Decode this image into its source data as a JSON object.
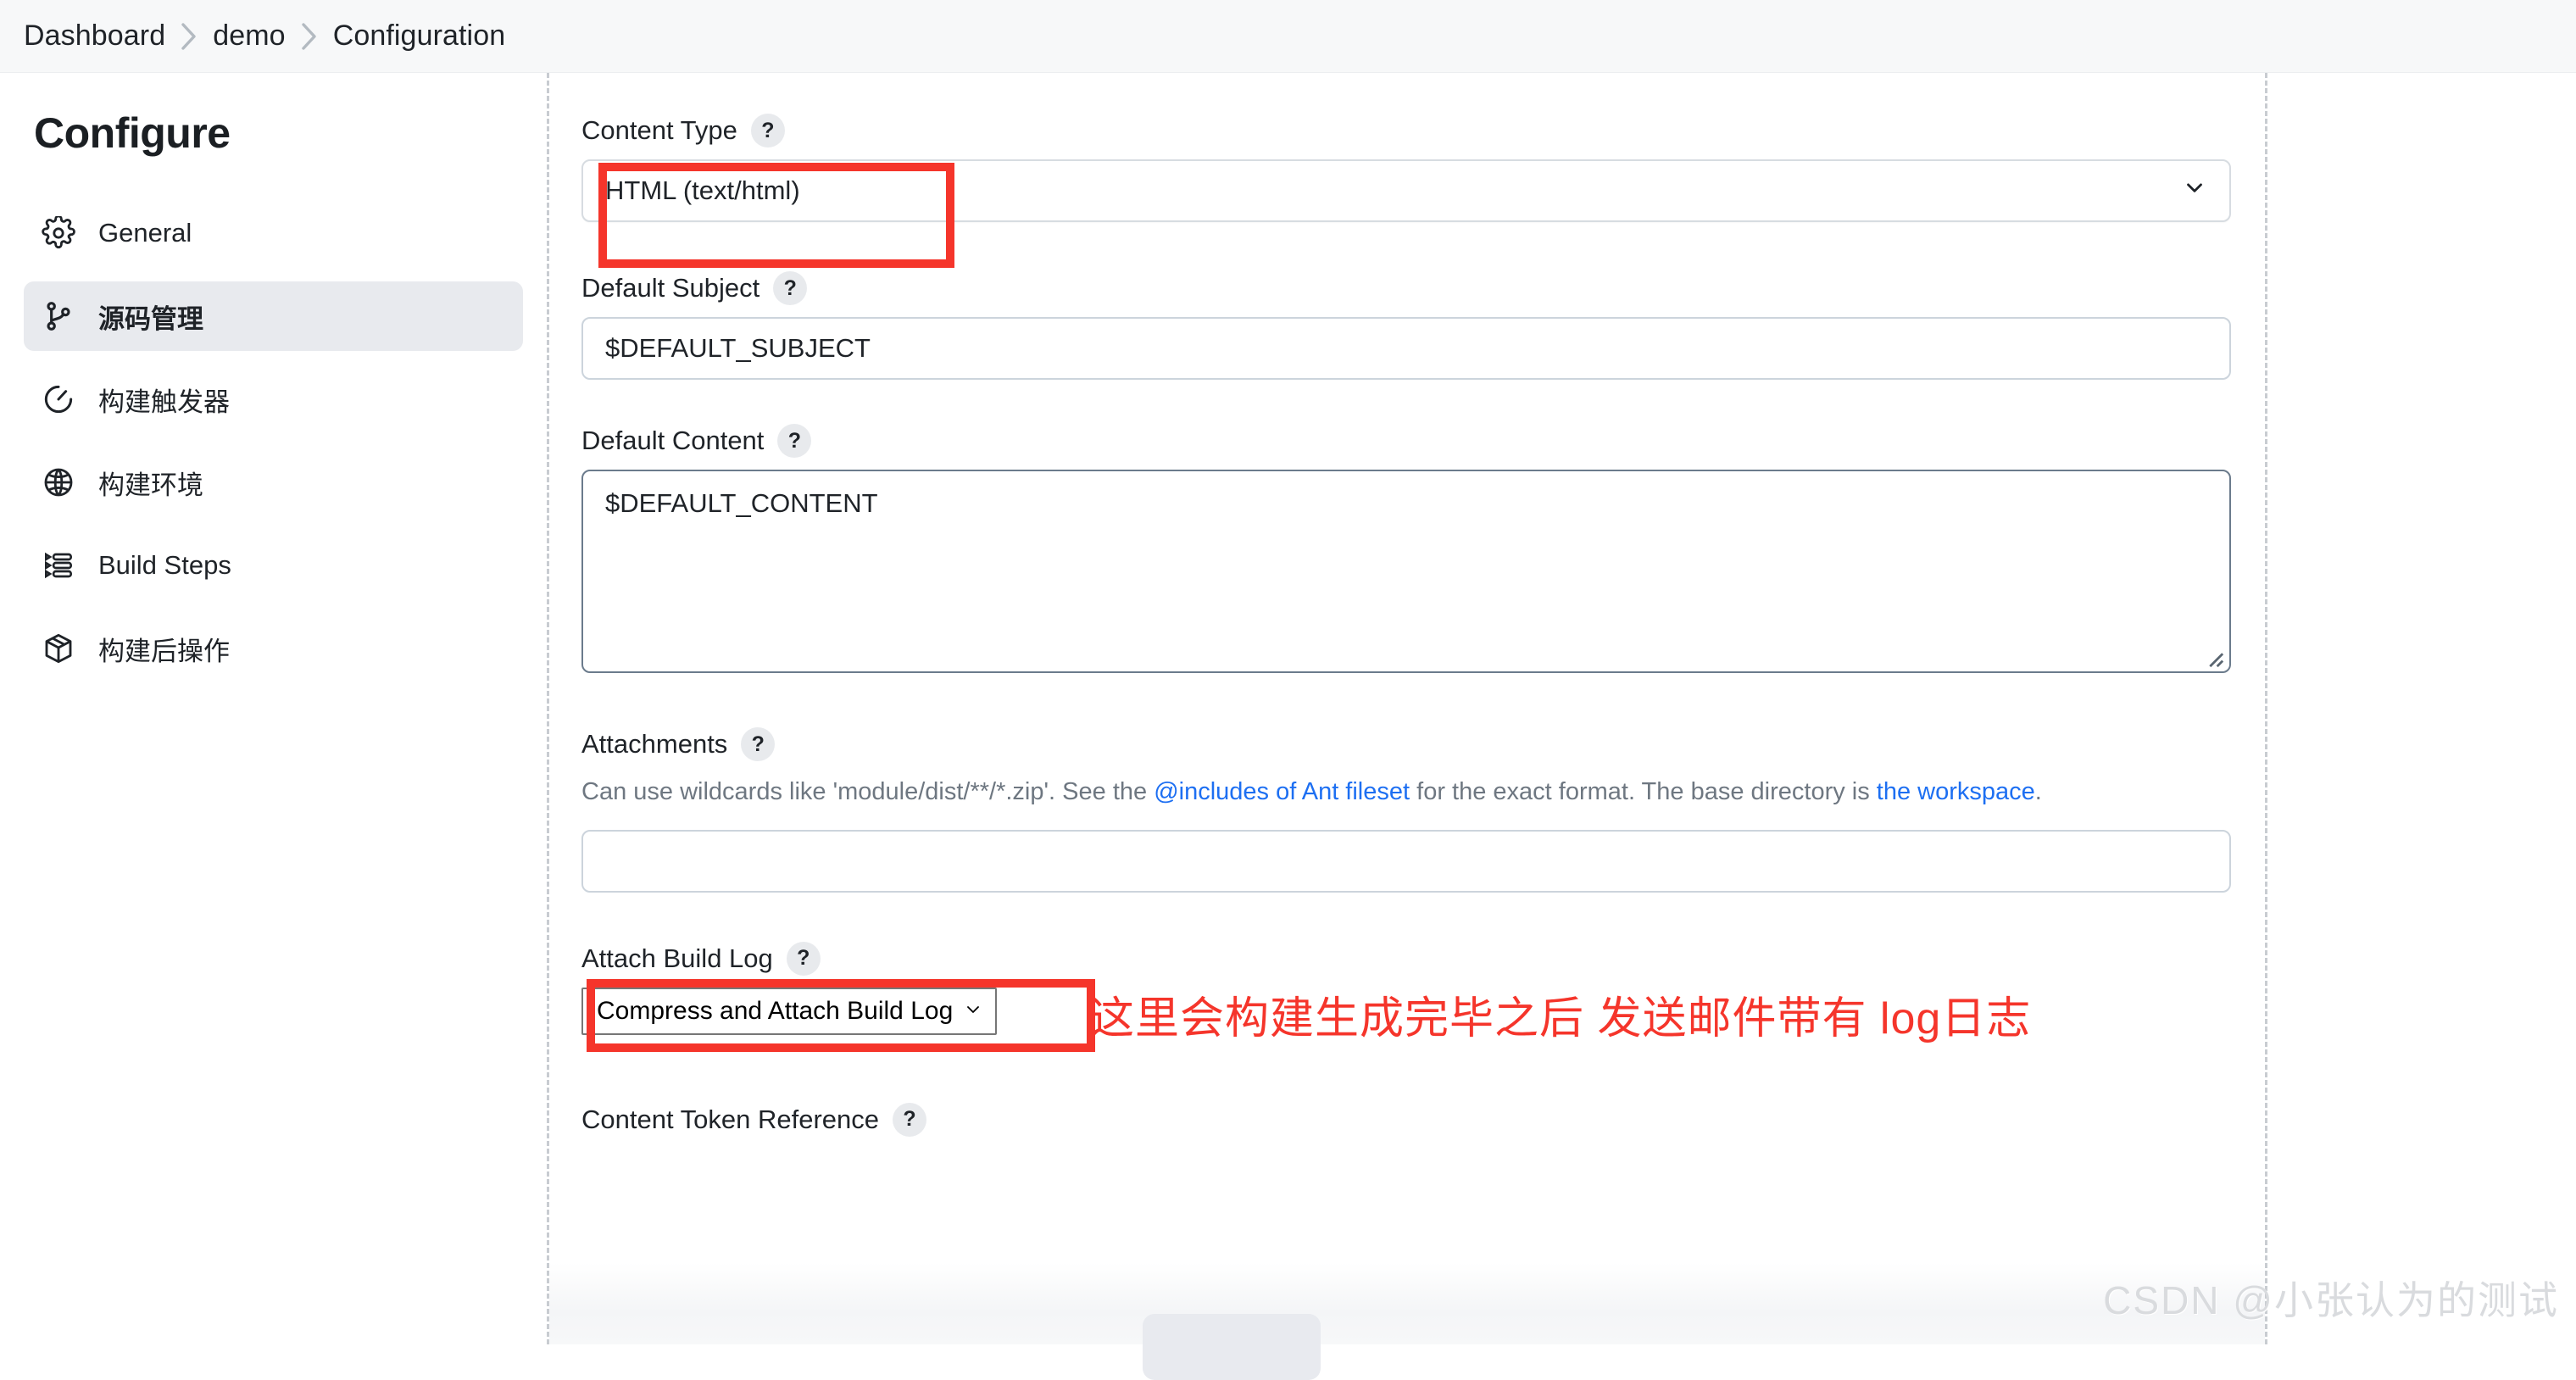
{
  "breadcrumb": {
    "items": [
      {
        "label": "Dashboard"
      },
      {
        "label": "demo"
      },
      {
        "label": "Configuration"
      }
    ],
    "separator_icon": "chevron-right-icon"
  },
  "sidebar": {
    "title": "Configure",
    "items": [
      {
        "label": "General",
        "icon": "gear-icon",
        "active": false
      },
      {
        "label": "源码管理",
        "icon": "branch-icon",
        "active": true
      },
      {
        "label": "构建触发器",
        "icon": "clock-icon",
        "active": false
      },
      {
        "label": "构建环境",
        "icon": "globe-icon",
        "active": false
      },
      {
        "label": "Build Steps",
        "icon": "list-icon",
        "active": false
      },
      {
        "label": "构建后操作",
        "icon": "package-icon",
        "active": false
      }
    ]
  },
  "form": {
    "help_badge": "?",
    "content_type": {
      "label": "Content Type",
      "value": "HTML (text/html)",
      "chevron_icon": "chevron-down-icon"
    },
    "default_subject": {
      "label": "Default Subject",
      "value": "$DEFAULT_SUBJECT",
      "placeholder": ""
    },
    "default_content": {
      "label": "Default Content",
      "value": "$DEFAULT_CONTENT",
      "placeholder": "",
      "resize_icon": "resize-grip-icon"
    },
    "attachments": {
      "label": "Attachments",
      "help_prefix": "Can use wildcards like 'module/dist/**/*.zip'. See the ",
      "help_link1": "@includes of Ant fileset",
      "help_mid": " for the exact format. The base directory is ",
      "help_link2": "the workspace",
      "help_suffix": ".",
      "value": "",
      "placeholder": ""
    },
    "attach_build_log": {
      "label": "Attach Build Log",
      "value": "Compress and Attach Build Log",
      "chevron_icon": "chevron-down-icon"
    },
    "content_token_reference": {
      "label": "Content Token Reference"
    }
  },
  "annotations": {
    "red_note": "这里会构建生成完毕之后 发送邮件带有 log日志",
    "red_color": "#f5352b"
  },
  "watermark": {
    "text": "CSDN @小张认为的测试"
  }
}
